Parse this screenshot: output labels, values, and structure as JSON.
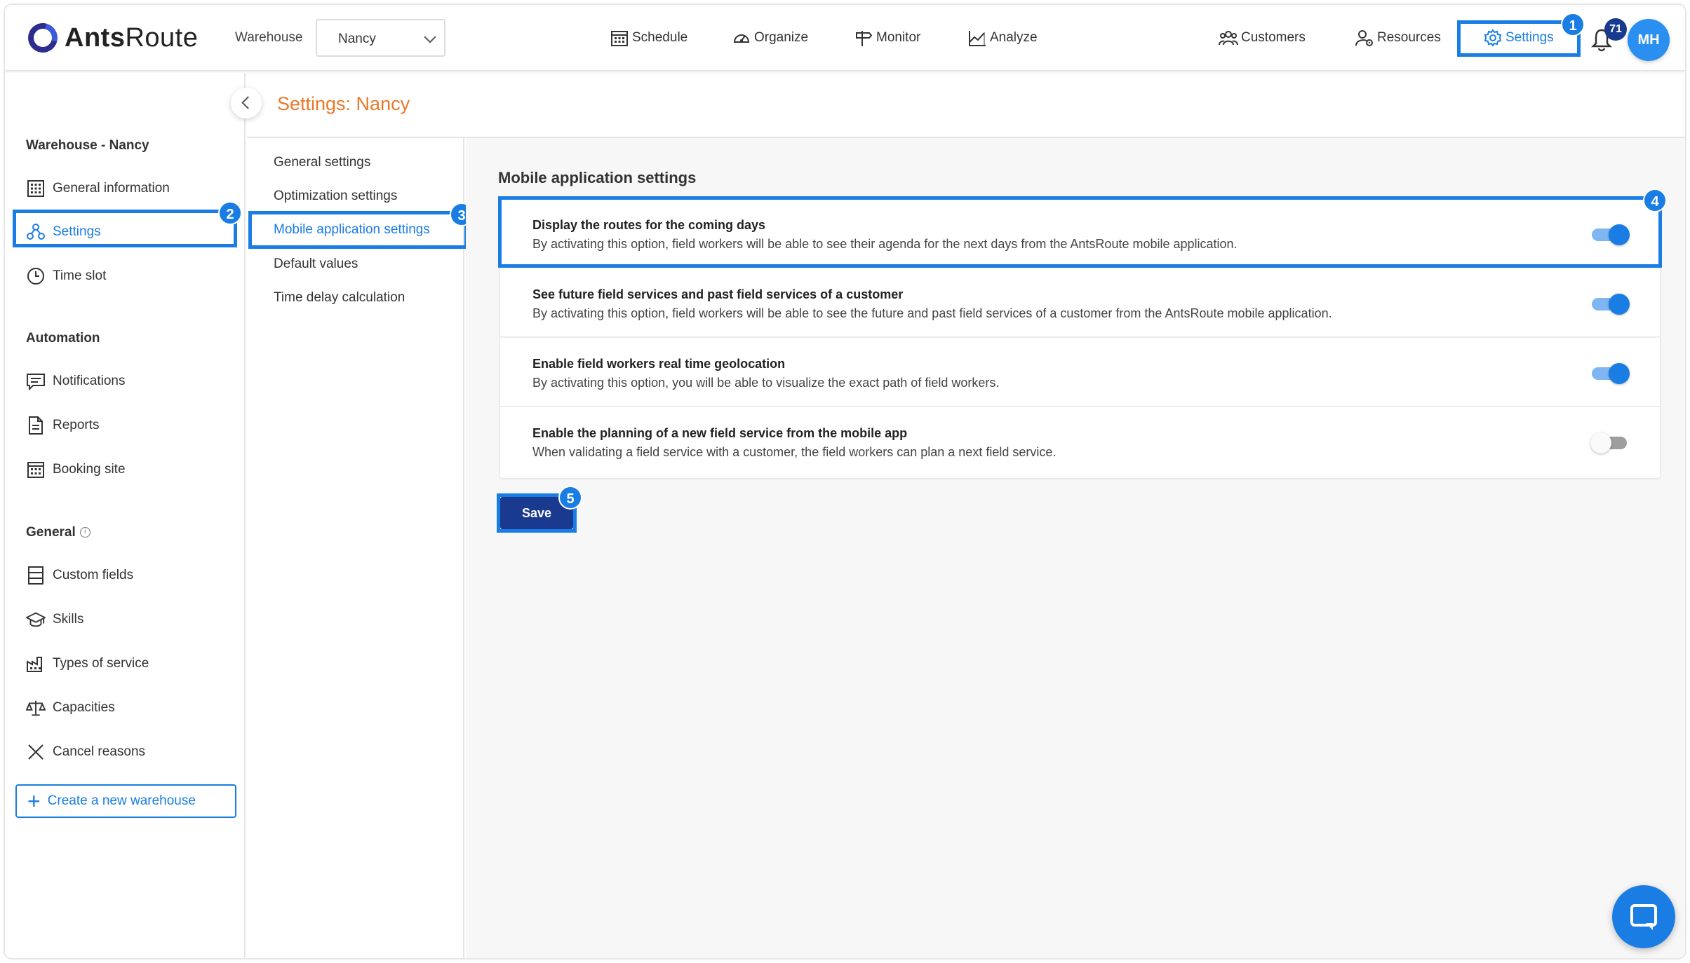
{
  "app": {
    "logo_text_bold": "Ants",
    "logo_text_light": "Route"
  },
  "header": {
    "warehouse_label": "Warehouse",
    "warehouse_value": "Nancy",
    "nav": [
      {
        "label": "Schedule",
        "icon": "calendar-icon"
      },
      {
        "label": "Organize",
        "icon": "gauge-icon"
      },
      {
        "label": "Monitor",
        "icon": "signpost-icon"
      },
      {
        "label": "Analyze",
        "icon": "chart-icon"
      },
      {
        "label": "Customers",
        "icon": "group-icon"
      },
      {
        "label": "Resources",
        "icon": "user-gear-icon"
      },
      {
        "label": "Settings",
        "icon": "gear-icon"
      }
    ],
    "notifications_count": "71",
    "avatar_initials": "MH"
  },
  "callouts": [
    "1",
    "2",
    "3",
    "4",
    "5"
  ],
  "sidebar": {
    "warehouse_heading": "Warehouse - Nancy",
    "warehouse_items": [
      {
        "label": "General information",
        "icon": "grid-icon"
      },
      {
        "label": "Settings",
        "icon": "nodes-icon"
      },
      {
        "label": "Time slot",
        "icon": "clock-icon"
      }
    ],
    "automation_heading": "Automation",
    "automation_items": [
      {
        "label": "Notifications",
        "icon": "message-icon"
      },
      {
        "label": "Reports",
        "icon": "document-icon"
      },
      {
        "label": "Booking site",
        "icon": "calendar-icon"
      }
    ],
    "general_heading": "General",
    "general_items": [
      {
        "label": "Custom fields",
        "icon": "list-icon"
      },
      {
        "label": "Skills",
        "icon": "graduation-cap-icon"
      },
      {
        "label": "Types of service",
        "icon": "factory-icon"
      },
      {
        "label": "Capacities",
        "icon": "scale-icon"
      },
      {
        "label": "Cancel reasons",
        "icon": "x-icon"
      }
    ],
    "create_label": "Create a new warehouse"
  },
  "page": {
    "title": "Settings: Nancy"
  },
  "submenu": {
    "items": [
      "General settings",
      "Optimization settings",
      "Mobile application settings",
      "Default values",
      "Time delay calculation"
    ],
    "active_index": 2
  },
  "main": {
    "section_title": "Mobile application settings",
    "options": [
      {
        "title": "Display the routes for the coming days",
        "description": "By activating this option, field workers will be able to see their agenda for the next days from the AntsRoute mobile application.",
        "enabled": true
      },
      {
        "title": "See future field services and past field services of a customer",
        "description": "By activating this option, field workers will be able to see the future and past field services of a customer from the AntsRoute mobile application.",
        "enabled": true
      },
      {
        "title": "Enable field workers real time geolocation",
        "description": "By activating this option, you will be able to visualize the exact path of field workers.",
        "enabled": true
      },
      {
        "title": "Enable the planning of a new field service from the mobile app",
        "description": "When validating a field service with a customer, the field workers can plan a next field service.",
        "enabled": false
      }
    ],
    "save_label": "Save"
  },
  "colors": {
    "accent": "#1a7de3",
    "title_orange": "#e8792b",
    "save_navy": "#1a3a8f"
  }
}
